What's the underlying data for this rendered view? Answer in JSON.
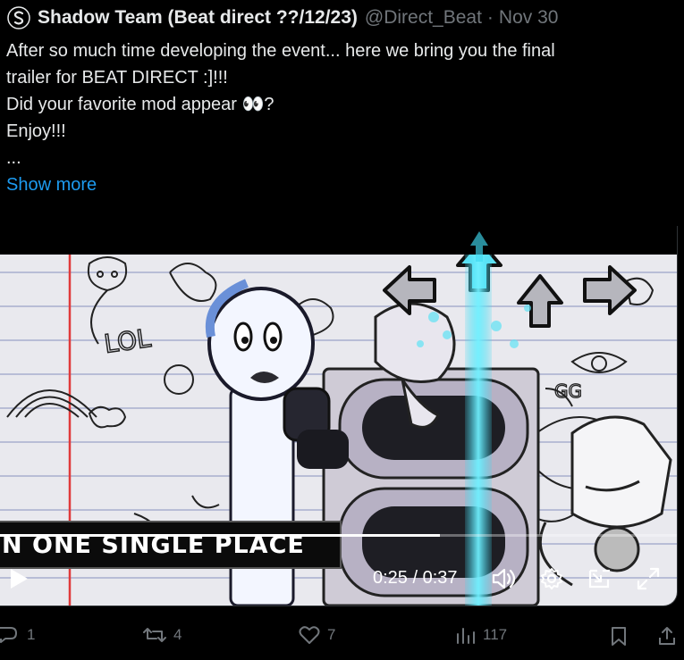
{
  "header": {
    "display_name": "Shadow Team (Beat direct ??/12/23)",
    "handle": "@Direct_Beat",
    "separator": "·",
    "date": "Nov 30"
  },
  "tweet": {
    "lines": [
      "After so much time developing the event... here we bring you the final",
      "trailer for BEAT DIRECT :]!!!",
      "Did your favorite mod appear 👀?",
      "Enjoy!!!",
      "..."
    ],
    "show_more": "Show more"
  },
  "video": {
    "caption": "N ONE SINGLE PLACE",
    "time": "0:25 / 0:37",
    "progress": 0.65
  },
  "actions": {
    "replies": "1",
    "reposts": "4",
    "likes": "7",
    "views": "117"
  },
  "colors": {
    "accent": "#1d9bf0",
    "muted": "#71767b",
    "text": "#e7e9ea",
    "arrow_cyan": "#3fd8f0"
  }
}
